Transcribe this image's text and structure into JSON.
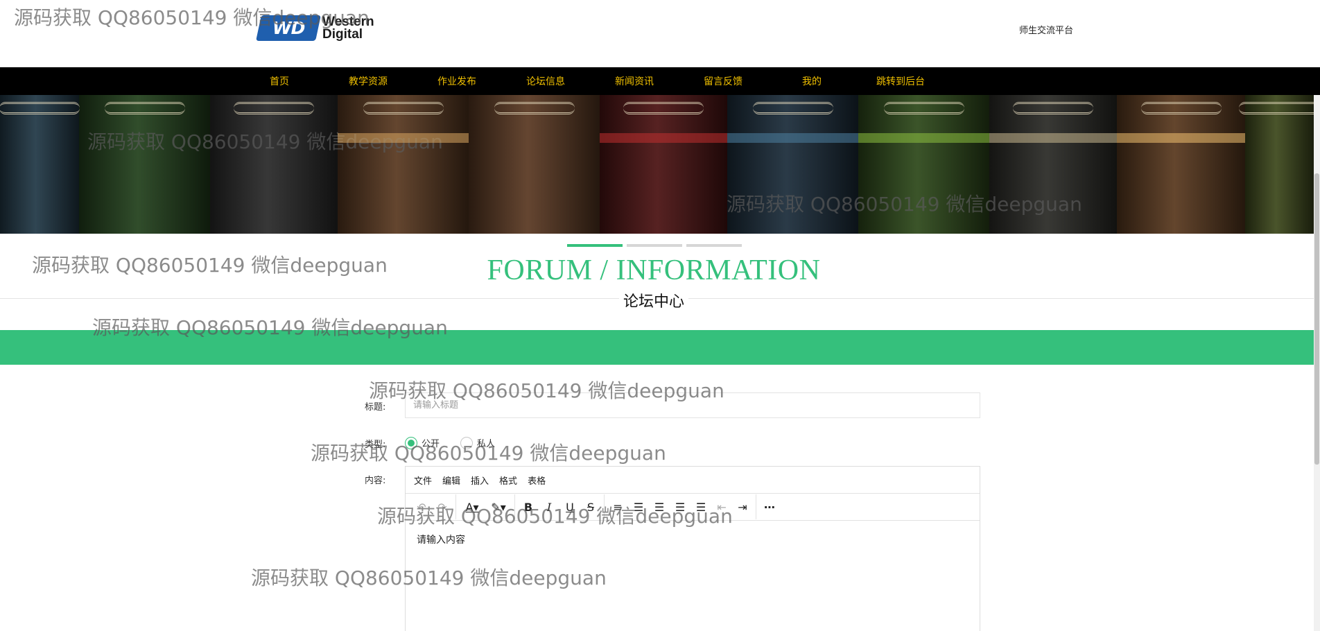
{
  "header": {
    "logo_text_line1": "Western",
    "logo_text_line2": "Digital",
    "logo_mark": "WD",
    "site_name": "师生交流平台"
  },
  "nav": {
    "items": [
      {
        "label": "首页"
      },
      {
        "label": "教学资源"
      },
      {
        "label": "作业发布"
      },
      {
        "label": "论坛信息"
      },
      {
        "label": "新闻资讯"
      },
      {
        "label": "留言反馈"
      },
      {
        "label": "我的"
      },
      {
        "label": "跳转到后台"
      }
    ],
    "text_color": "#f0c000",
    "background": "#000000"
  },
  "carousel": {
    "slides": 3,
    "active_index": 0,
    "accent": "#35c07c"
  },
  "section": {
    "title_en": "FORUM / INFORMATION",
    "title_cn": "论坛中心",
    "accent": "#35c07c"
  },
  "form": {
    "title_label": "标题:",
    "title_placeholder": "请输入标题",
    "type_label": "类型:",
    "type_options": [
      {
        "label": "公开",
        "checked": true
      },
      {
        "label": "私人",
        "checked": false
      }
    ],
    "content_label": "内容:",
    "editor": {
      "menus": [
        "文件",
        "编辑",
        "插入",
        "格式",
        "表格"
      ],
      "toolbar_icons": [
        "undo-icon",
        "redo-icon",
        "font-color-icon",
        "highlight-icon",
        "bold-icon",
        "italic-icon",
        "underline-icon",
        "strikethrough-icon",
        "line-height-icon",
        "align-left-icon",
        "align-center-icon",
        "align-right-icon",
        "align-justify-icon",
        "outdent-icon",
        "indent-icon",
        "more-icon"
      ],
      "placeholder": "请输入内容"
    }
  },
  "watermarks": [
    "源码获取 QQ86050149 微信deepguan",
    "源码获取 QQ86050149 微信deepguan",
    "源码获取 QQ86050149 微信deepguan",
    "源码获取 QQ86050149 微信deepguan",
    "源码获取 QQ86050149 微信deepguan",
    "源码获取 QQ86050149 微信deepguan",
    "源码获取 QQ86050149 微信deepguan",
    "源码获取 QQ86050149 微信deepguan",
    "源码获取 QQ86050149 微信deepguan"
  ]
}
